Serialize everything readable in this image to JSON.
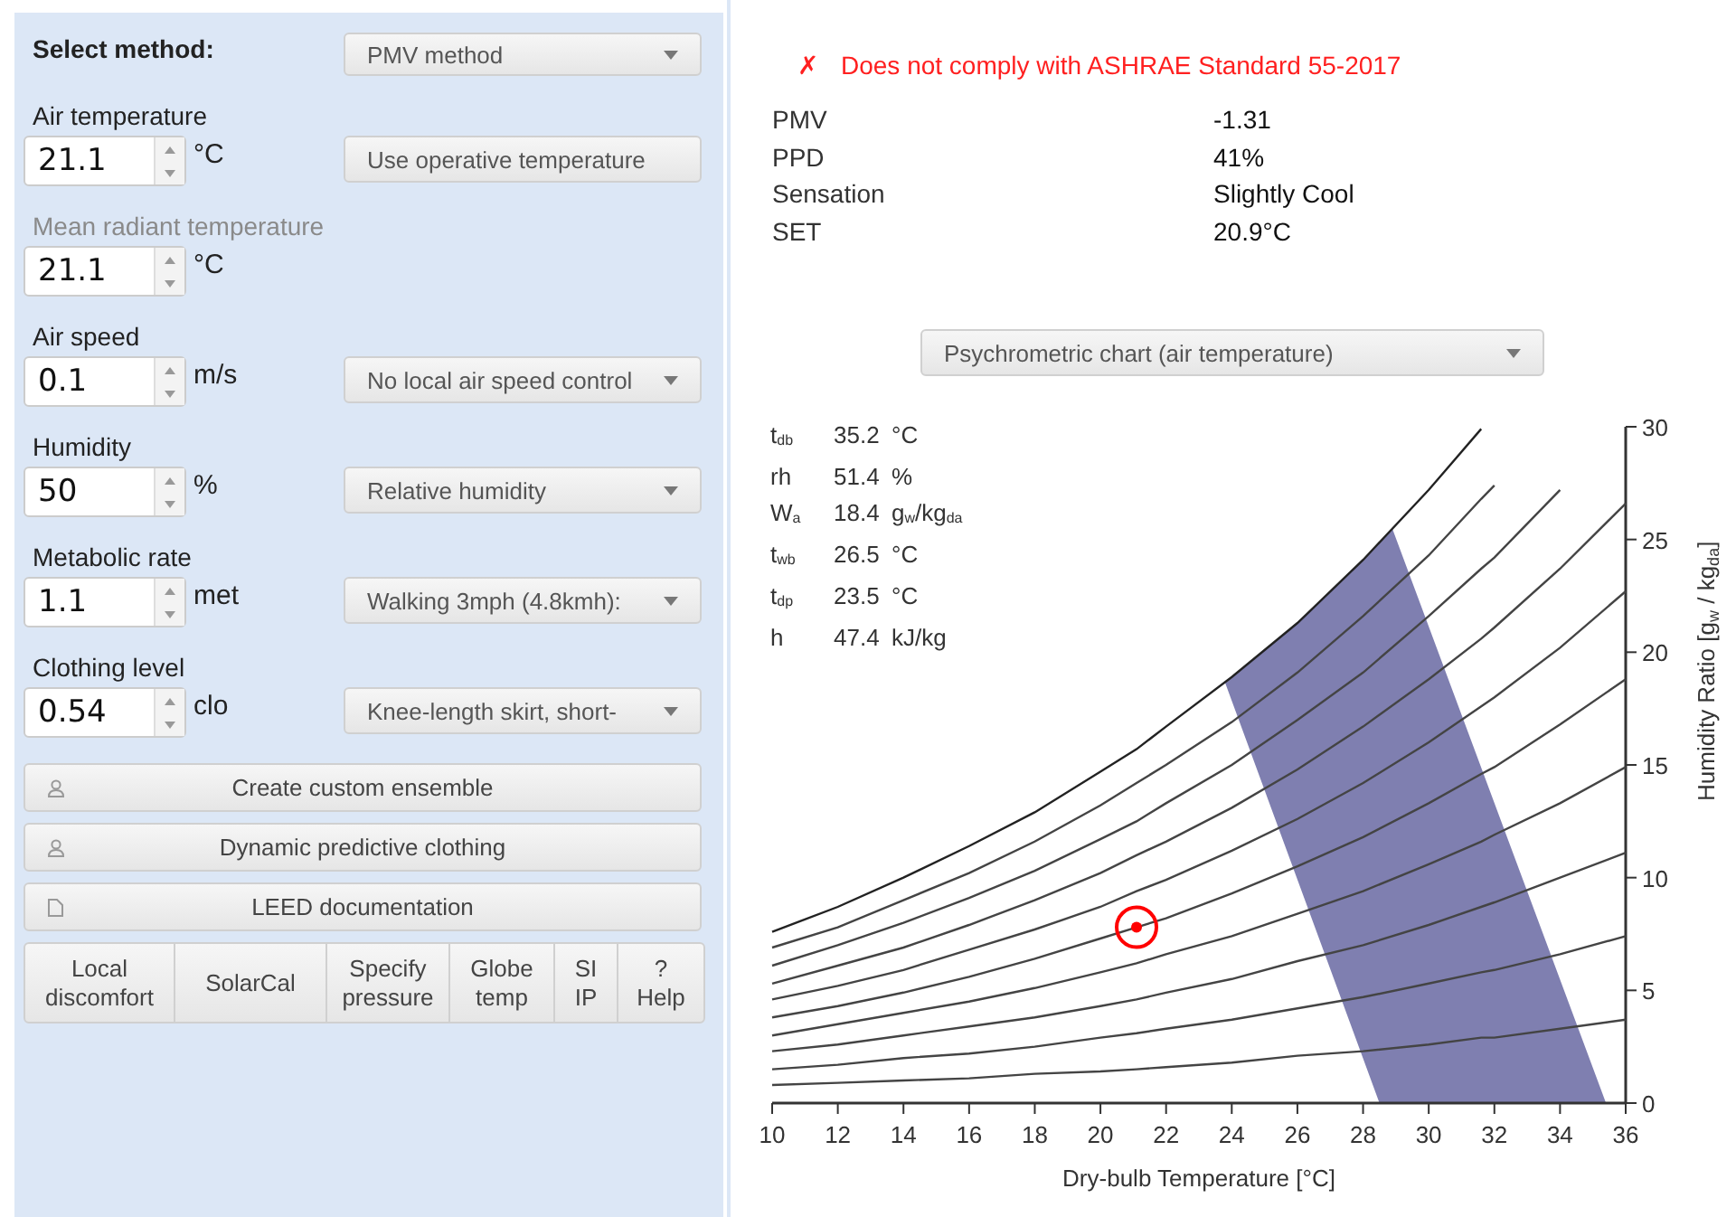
{
  "method": {
    "label": "Select method:",
    "value": "PMV method"
  },
  "inputs": [
    {
      "label": "Air temperature",
      "value": "21.1",
      "unit": "°C",
      "disabled": false,
      "control": {
        "kind": "button",
        "text": "Use operative temperature"
      }
    },
    {
      "label": "Mean radiant temperature",
      "value": "21.1",
      "unit": "°C",
      "disabled": true
    },
    {
      "label": "Air speed",
      "value": "0.1",
      "unit": "m/s",
      "disabled": false,
      "control": {
        "kind": "select",
        "text": "No local air speed control"
      }
    },
    {
      "label": "Humidity",
      "value": "50",
      "unit": "%",
      "disabled": false,
      "control": {
        "kind": "select",
        "text": "Relative humidity"
      }
    },
    {
      "label": "Metabolic rate",
      "value": "1.1",
      "unit": "met",
      "disabled": false,
      "control": {
        "kind": "select",
        "text": "Walking 3mph (4.8kmh):"
      }
    },
    {
      "label": "Clothing level",
      "value": "0.54",
      "unit": "clo",
      "disabled": false,
      "control": {
        "kind": "select",
        "text": "Knee-length skirt, short-"
      }
    }
  ],
  "wide_buttons": [
    {
      "label": "Create custom ensemble",
      "kind": "clothing"
    },
    {
      "label": "Dynamic predictive clothing",
      "kind": "clothing"
    },
    {
      "label": "LEED documentation",
      "kind": "document"
    }
  ],
  "tool_buttons": [
    "Local\ndiscomfort",
    "SolarCal",
    "Specify\npressure",
    "Globe\ntemp",
    "SI\nIP",
    "?\nHelp"
  ],
  "compliance": {
    "complies": false,
    "icon": "✗",
    "message": "Does not comply with ASHRAE Standard 55-2017"
  },
  "results": [
    {
      "label": "PMV",
      "value": "-1.31"
    },
    {
      "label": "PPD",
      "value": "41%"
    },
    {
      "label": "Sensation",
      "value": "Slightly Cool"
    },
    {
      "label": "SET",
      "value": "20.9°C"
    }
  ],
  "chart_selector": "Psychrometric chart (air temperature)",
  "chart": {
    "readout": [
      {
        "label": "t$_{db}$",
        "value": "35.2",
        "unit": "°C"
      },
      {
        "label": "rh",
        "value": "51.4",
        "unit": "%"
      },
      {
        "label": "W$_{a}$",
        "value": "18.4",
        "unit": "g$_{w}$/kg$_{da}$"
      },
      {
        "label": "t$_{wb}$",
        "value": "26.5",
        "unit": "°C"
      },
      {
        "label": "t$_{dp}$",
        "value": "23.5",
        "unit": "°C"
      },
      {
        "label": "h",
        "value": "47.4",
        "unit": "kJ/kg"
      }
    ],
    "chart_data": {
      "type": "line",
      "xlabel": "Dry-bulb Temperature [°C]",
      "ylabel": "Humidity Ratio [g$_{w}$ / kg$_{da}$]",
      "xlim": [
        10,
        36
      ],
      "ylim": [
        0,
        30
      ],
      "xticks": [
        10,
        12,
        14,
        16,
        18,
        20,
        22,
        24,
        26,
        28,
        30,
        32,
        34,
        36
      ],
      "yticks": [
        0,
        5,
        10,
        15,
        20,
        25,
        30
      ],
      "x": [
        10,
        12,
        14,
        16,
        18,
        20,
        21.1,
        22,
        24,
        26,
        28,
        30,
        31.6,
        32,
        34,
        36
      ],
      "series": [
        {
          "color": "#444444",
          "values": [
            0.8,
            0.9,
            1.0,
            1.1,
            1.3,
            1.4,
            1.5,
            1.6,
            1.8,
            2.1,
            2.3,
            2.6,
            2.9,
            2.9,
            3.3,
            3.7
          ]
        },
        {
          "color": "#444444",
          "values": [
            1.5,
            1.7,
            2.0,
            2.2,
            2.5,
            2.9,
            3.1,
            3.3,
            3.7,
            4.2,
            4.7,
            5.3,
            5.8,
            5.9,
            6.6,
            7.4
          ]
        },
        {
          "color": "#444444",
          "values": [
            2.3,
            2.6,
            3.0,
            3.4,
            3.8,
            4.3,
            4.6,
            4.9,
            5.5,
            6.3,
            7.0,
            7.9,
            8.7,
            8.9,
            10.0,
            11.1
          ]
        },
        {
          "color": "#444444",
          "values": [
            3.0,
            3.5,
            4.0,
            4.5,
            5.1,
            5.8,
            6.2,
            6.6,
            7.4,
            8.4,
            9.4,
            10.6,
            11.6,
            11.9,
            13.3,
            14.9
          ]
        },
        {
          "color": "#444444",
          "values": [
            3.8,
            4.3,
            4.9,
            5.6,
            6.4,
            7.3,
            7.8,
            8.2,
            9.3,
            10.5,
            11.8,
            13.3,
            14.6,
            14.9,
            16.8,
            18.8
          ]
        },
        {
          "color": "#444444",
          "values": [
            4.6,
            5.2,
            5.9,
            6.8,
            7.7,
            8.7,
            9.4,
            9.9,
            11.2,
            12.6,
            14.2,
            16.0,
            17.6,
            18.0,
            20.2,
            22.7
          ]
        },
        {
          "color": "#444444",
          "values": [
            5.3,
            6.1,
            6.9,
            7.9,
            9.0,
            10.2,
            11.0,
            11.6,
            13.1,
            14.8,
            16.7,
            18.8,
            20.6,
            21.1,
            23.7,
            26.6
          ]
        },
        {
          "color": "#444444",
          "values": [
            6.1,
            7.0,
            8.0,
            9.1,
            10.3,
            11.7,
            12.5,
            13.3,
            15.0,
            17.0,
            19.1,
            21.6,
            23.7,
            24.2,
            27.2,
            null
          ]
        },
        {
          "color": "#444444",
          "values": [
            6.9,
            7.8,
            9.0,
            10.2,
            11.6,
            13.2,
            14.2,
            15.0,
            16.9,
            19.1,
            21.6,
            24.3,
            26.8,
            27.4,
            null,
            null
          ]
        },
        {
          "color": "#222222",
          "values": [
            7.6,
            8.7,
            10.0,
            11.4,
            12.9,
            14.7,
            15.7,
            16.7,
            18.9,
            21.3,
            24.1,
            27.2,
            29.9,
            null,
            null,
            null
          ]
        },
        {
          "color": "#ff0000",
          "marker": "circle",
          "values": [
            null,
            null,
            null,
            null,
            null,
            null,
            7.8,
            null,
            null,
            null,
            null,
            null,
            null,
            null,
            null,
            null
          ]
        }
      ]
    }
  }
}
